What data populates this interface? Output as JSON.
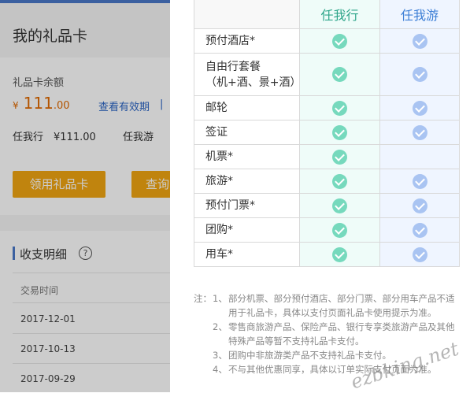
{
  "left_panel": {
    "page_title": "我的礼品卡",
    "balance_label": "礼品卡余额",
    "currency": "¥",
    "amount_int": "111",
    "amount_dec": ".00",
    "view_validity_link": "查看有效期",
    "separator": "|",
    "balance_renwoxing": "任我行　¥111.00",
    "balance_renwoyou": "任我游",
    "get_card_button": "领用礼品卡",
    "query_button": "查询",
    "detail_title": "收支明细",
    "help_icon_glyph": "?",
    "table_header_time": "交易时间",
    "dates": [
      "2017-12-01",
      "2017-10-13",
      "2017-09-29"
    ],
    "accent_color": "#f0a512"
  },
  "comparison": {
    "col1_header": "任我行",
    "col2_header": "任我游",
    "rows": [
      {
        "name": "预付酒店*",
        "c1": true,
        "c2": true
      },
      {
        "name": "自由行套餐\n（机+酒、景+酒）",
        "c1": true,
        "c2": true
      },
      {
        "name": "邮轮",
        "c1": true,
        "c2": true
      },
      {
        "name": "签证",
        "c1": true,
        "c2": true
      },
      {
        "name": "机票*",
        "c1": true,
        "c2": false
      },
      {
        "name": "旅游*",
        "c1": true,
        "c2": true
      },
      {
        "name": "预付门票*",
        "c1": true,
        "c2": true
      },
      {
        "name": "团购*",
        "c1": true,
        "c2": true
      },
      {
        "name": "用车*",
        "c1": true,
        "c2": true
      }
    ],
    "check_icon": "check-circle-icon",
    "green": "#76d9bd",
    "blue": "#a9c4f2"
  },
  "notes": {
    "prefix": "注：",
    "items": [
      {
        "num": "1、",
        "text": "部分机票、部分预付酒店、部分门票、部分用车产品不适用于礼品卡，具体以支付页面礼品卡使用提示为准。"
      },
      {
        "num": "2、",
        "text": "零售商旅游产品、保险产品、银行专享类旅游产品及其他特殊产品等暂不支持礼品卡支付。"
      },
      {
        "num": "3、",
        "text": "团购中非旅游类产品不支持礼品卡支付。"
      },
      {
        "num": "4、",
        "text": "不与其他优惠同享，具体以订单实际支付页面为准。"
      }
    ]
  },
  "watermark": "ezbking.net"
}
